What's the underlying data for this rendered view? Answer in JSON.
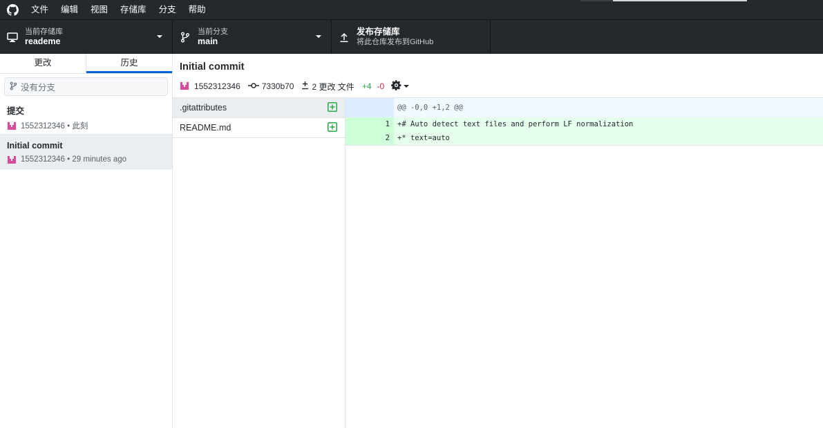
{
  "menu": {
    "items": [
      "文件",
      "编辑",
      "视图",
      "存储库",
      "分支",
      "帮助"
    ]
  },
  "toolbar": {
    "repo": {
      "caption": "当前存储库",
      "value": "reademe"
    },
    "branch": {
      "caption": "当前分支",
      "value": "main"
    },
    "publish": {
      "title": "发布存储库",
      "subtitle": "将此仓库发布到GitHub"
    }
  },
  "sidebar": {
    "tabs": [
      "更改",
      "历史"
    ],
    "active_tab": "历史",
    "branch_filter_placeholder": "没有分支",
    "commits": [
      {
        "title": "提交",
        "author": "1552312346",
        "time": "此刻",
        "meta": "1552312346 • 此刻",
        "selected": false
      },
      {
        "title": "Initial commit",
        "author": "1552312346",
        "time": "29 minutes ago",
        "meta": "1552312346 • 29 minutes ago",
        "selected": true
      }
    ]
  },
  "commit": {
    "title": "Initial commit",
    "author": "1552312346",
    "sha": "7330b70",
    "changes": "2 更改 文件",
    "additions": "+4",
    "deletions": "-0"
  },
  "files": [
    {
      "name": ".gitattributes",
      "selected": true
    },
    {
      "name": "README.md",
      "selected": false
    }
  ],
  "diff": {
    "hunk_header": "@@ -0,0 +1,2 @@",
    "lines": [
      {
        "num": "1",
        "text": "+# Auto detect text files and perform LF normalization"
      },
      {
        "num": "2",
        "text": "+* text=auto"
      }
    ]
  },
  "colors": {
    "titlebar_bg": "#24292e",
    "accent_blue": "#0366d6",
    "addition_green": "#28a745",
    "deletion_red": "#cb2431"
  },
  "icons": {
    "app": "github-mark-icon",
    "repo": "desktop-computer-icon",
    "branch": "git-branch-icon",
    "publish": "upload-arrow-icon",
    "commit": "git-commit-icon",
    "diff_stat": "diff-plus-minus-icon",
    "settings": "gear-icon",
    "file_added": "plus-square-icon"
  }
}
